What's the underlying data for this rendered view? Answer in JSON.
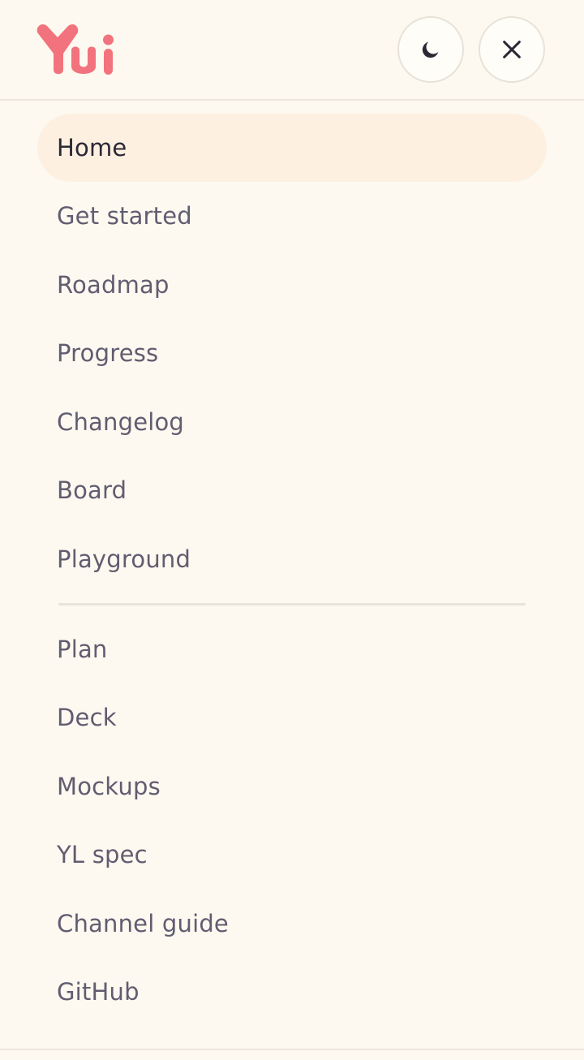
{
  "brand": {
    "logo_text": "Yui",
    "logo_color": "#f2737d"
  },
  "header": {
    "theme_toggle_icon": "moon-icon",
    "close_icon": "close-icon"
  },
  "nav": {
    "primary": [
      {
        "label": "Home",
        "active": true
      },
      {
        "label": "Get started",
        "active": false
      },
      {
        "label": "Roadmap",
        "active": false
      },
      {
        "label": "Progress",
        "active": false
      },
      {
        "label": "Changelog",
        "active": false
      },
      {
        "label": "Board",
        "active": false
      },
      {
        "label": "Playground",
        "active": false
      }
    ],
    "secondary": [
      {
        "label": "Plan"
      },
      {
        "label": "Deck"
      },
      {
        "label": "Mockups"
      },
      {
        "label": "YL spec"
      },
      {
        "label": "Channel guide"
      },
      {
        "label": "GitHub"
      }
    ]
  },
  "colors": {
    "background": "#fdf9f0",
    "active_item_bg": "#fdf0e1",
    "text_active": "#2a2835",
    "text_muted": "#615c70"
  }
}
